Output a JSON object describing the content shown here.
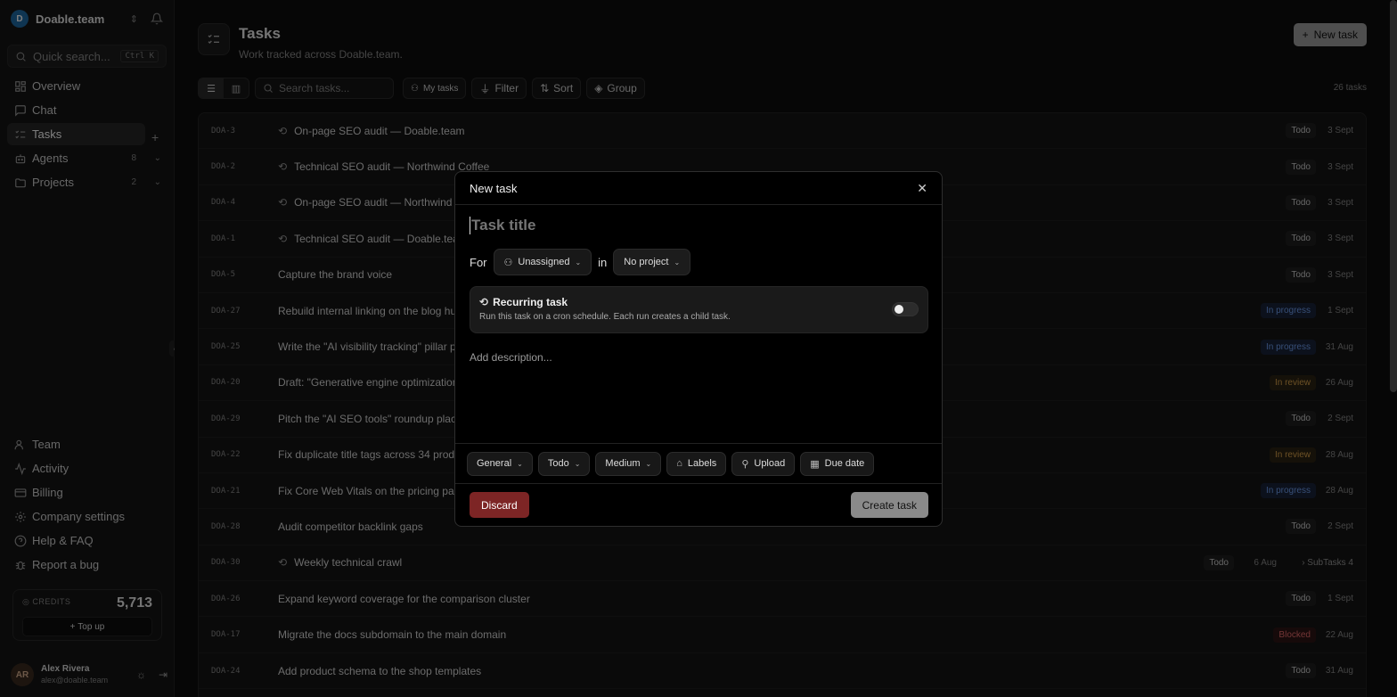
{
  "workspace": {
    "initial": "D",
    "name": "Doable.team"
  },
  "quick_search": {
    "label": "Quick search...",
    "shortcut": "Ctrl K"
  },
  "nav": [
    {
      "label": "Overview"
    },
    {
      "label": "Chat"
    },
    {
      "label": "Tasks"
    },
    {
      "label": "Agents",
      "count": "8"
    },
    {
      "label": "Projects",
      "count": "2"
    }
  ],
  "nav_bottom": [
    {
      "label": "Team"
    },
    {
      "label": "Activity"
    },
    {
      "label": "Billing"
    },
    {
      "label": "Company settings"
    },
    {
      "label": "Help & FAQ"
    },
    {
      "label": "Report a bug"
    }
  ],
  "credits": {
    "label": "CREDITS",
    "value": "5,713",
    "topup": "Top up"
  },
  "user": {
    "initials": "AR",
    "name": "Alex Rivera",
    "email": "alex@doable.team"
  },
  "header": {
    "title": "Tasks",
    "subtitle": "Work tracked across Doable.team.",
    "new_task": "New task"
  },
  "toolbar": {
    "search_placeholder": "Search tasks...",
    "my_tasks": "My tasks",
    "filter": "Filter",
    "sort": "Sort",
    "group": "Group",
    "count": "26 tasks"
  },
  "tasks": [
    {
      "id": "DOA-3",
      "title": "On-page SEO audit — Doable.team",
      "recurring": true,
      "status": "Todo",
      "date": "3 Sept"
    },
    {
      "id": "DOA-2",
      "title": "Technical SEO audit — Northwind Coffee",
      "recurring": true,
      "status": "Todo",
      "date": "3 Sept"
    },
    {
      "id": "DOA-4",
      "title": "On-page SEO audit — Northwind Coffee",
      "recurring": true,
      "status": "Todo",
      "date": "3 Sept"
    },
    {
      "id": "DOA-1",
      "title": "Technical SEO audit — Doable.team",
      "recurring": true,
      "status": "Todo",
      "date": "3 Sept"
    },
    {
      "id": "DOA-5",
      "title": "Capture the brand voice",
      "recurring": false,
      "status": "Todo",
      "date": "3 Sept"
    },
    {
      "id": "DOA-27",
      "title": "Rebuild internal linking on the blog hub",
      "recurring": false,
      "status": "In progress",
      "date": "1 Sept"
    },
    {
      "id": "DOA-25",
      "title": "Write the \"AI visibility tracking\" pillar page",
      "recurring": false,
      "status": "In progress",
      "date": "31 Aug"
    },
    {
      "id": "DOA-20",
      "title": "Draft: \"Generative engine optimization explained\"",
      "recurring": false,
      "status": "In review",
      "date": "26 Aug"
    },
    {
      "id": "DOA-29",
      "title": "Pitch the \"AI SEO tools\" roundup placement",
      "recurring": false,
      "status": "Todo",
      "date": "2 Sept"
    },
    {
      "id": "DOA-22",
      "title": "Fix duplicate title tags across 34 product pages",
      "recurring": false,
      "status": "In review",
      "date": "28 Aug"
    },
    {
      "id": "DOA-21",
      "title": "Fix Core Web Vitals on the pricing page",
      "recurring": false,
      "status": "In progress",
      "date": "28 Aug"
    },
    {
      "id": "DOA-28",
      "title": "Audit competitor backlink gaps",
      "recurring": false,
      "status": "Todo",
      "date": "2 Sept"
    },
    {
      "id": "DOA-30",
      "title": "Weekly technical crawl",
      "recurring": true,
      "status": "Todo",
      "date": "6 Aug",
      "subtasks": "SubTasks 4"
    },
    {
      "id": "DOA-26",
      "title": "Expand keyword coverage for the comparison cluster",
      "recurring": false,
      "status": "Todo",
      "date": "1 Sept"
    },
    {
      "id": "DOA-17",
      "title": "Migrate the docs subdomain to the main domain",
      "recurring": false,
      "status": "Blocked",
      "date": "22 Aug"
    },
    {
      "id": "DOA-24",
      "title": "Add product schema to the shop templates",
      "recurring": false,
      "status": "Todo",
      "date": "31 Aug"
    }
  ],
  "modal": {
    "title": "New task",
    "task_title_placeholder": "Task title",
    "for_label": "For",
    "assignee": "Unassigned",
    "in_label": "in",
    "project": "No project",
    "recurring_title": "Recurring task",
    "recurring_desc": "Run this task on a cron schedule. Each run creates a child task.",
    "recurring_on": false,
    "description_placeholder": "Add description...",
    "type": "General",
    "status": "Todo",
    "priority": "Medium",
    "labels": "Labels",
    "upload": "Upload",
    "due_date": "Due date",
    "discard": "Discard",
    "create": "Create task"
  }
}
